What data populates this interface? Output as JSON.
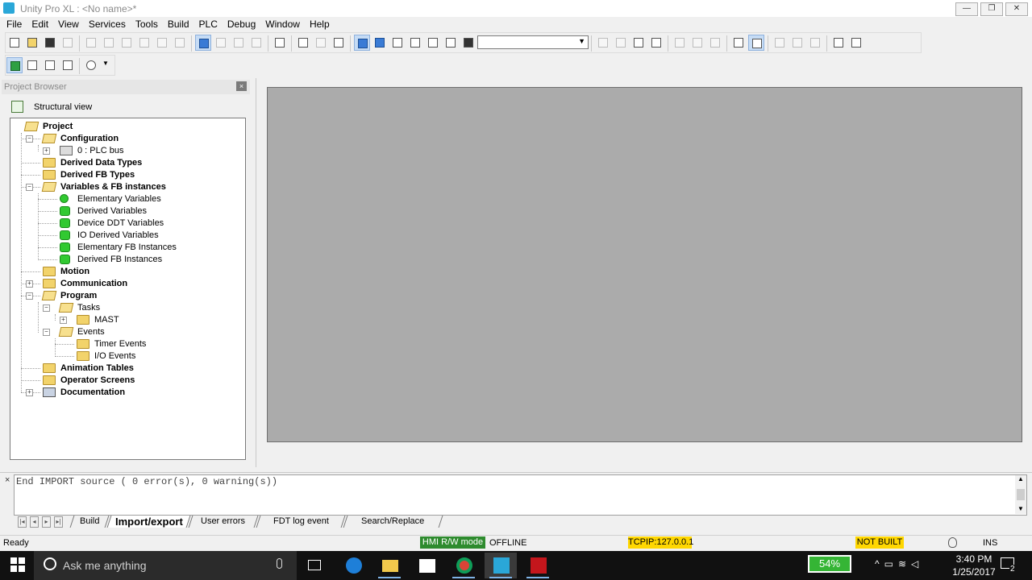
{
  "window": {
    "title": "Unity Pro XL : <No name>*",
    "minimize": "—",
    "restore": "❐",
    "close": "✕"
  },
  "menu": [
    "File",
    "Edit",
    "View",
    "Services",
    "Tools",
    "Build",
    "PLC",
    "Debug",
    "Window",
    "Help"
  ],
  "project_browser": {
    "title": "Project Browser",
    "close": "×",
    "view_label": "Structural view",
    "tree": [
      {
        "label": "Project",
        "bold": true,
        "icon": "folder-open"
      },
      {
        "label": "Configuration",
        "bold": true,
        "icon": "folder-open"
      },
      {
        "label": "0 : PLC bus",
        "bold": false,
        "icon": "plc"
      },
      {
        "label": "Derived Data Types",
        "bold": true,
        "icon": "folder"
      },
      {
        "label": "Derived FB Types",
        "bold": true,
        "icon": "folder"
      },
      {
        "label": "Variables & FB instances",
        "bold": true,
        "icon": "folder-open"
      },
      {
        "label": "Elementary Variables",
        "bold": false,
        "icon": "var-round"
      },
      {
        "label": "Derived Variables",
        "bold": false,
        "icon": "var"
      },
      {
        "label": "Device DDT Variables",
        "bold": false,
        "icon": "var"
      },
      {
        "label": "IO Derived Variables",
        "bold": false,
        "icon": "var"
      },
      {
        "label": "Elementary FB Instances",
        "bold": false,
        "icon": "var"
      },
      {
        "label": "Derived FB Instances",
        "bold": false,
        "icon": "var"
      },
      {
        "label": "Motion",
        "bold": true,
        "icon": "folder"
      },
      {
        "label": "Communication",
        "bold": true,
        "icon": "folder"
      },
      {
        "label": "Program",
        "bold": true,
        "icon": "folder-open"
      },
      {
        "label": "Tasks",
        "bold": false,
        "icon": "folder-open"
      },
      {
        "label": "MAST",
        "bold": false,
        "icon": "folder"
      },
      {
        "label": "Events",
        "bold": false,
        "icon": "folder-open"
      },
      {
        "label": "Timer Events",
        "bold": false,
        "icon": "folder"
      },
      {
        "label": "I/O Events",
        "bold": false,
        "icon": "folder"
      },
      {
        "label": "Animation Tables",
        "bold": true,
        "icon": "folder"
      },
      {
        "label": "Operator Screens",
        "bold": true,
        "icon": "folder"
      },
      {
        "label": "Documentation",
        "bold": true,
        "icon": "doc"
      }
    ]
  },
  "output": {
    "close": "×",
    "message": "End IMPORT source ( 0 error(s), 0 warning(s))",
    "tabs": [
      "Build",
      "Import/export",
      "User errors",
      "FDT log event",
      "Search/Replace"
    ],
    "selected_tab": "Import/export"
  },
  "status": {
    "ready": "Ready",
    "hmi_mode": "HMI R/W mode",
    "connection": "OFFLINE",
    "address": "TCPIP:127.0.0.1",
    "build_state": "NOT BUILT",
    "ins": "INS"
  },
  "taskbar": {
    "search_placeholder": "Ask me anything",
    "battery": "54%",
    "time": "3:40 PM",
    "date": "1/25/2017",
    "notifications": "2"
  },
  "colors": {
    "hmi": "#2e8b2e",
    "warning": "#ffd700",
    "canvas": "#ababab"
  }
}
